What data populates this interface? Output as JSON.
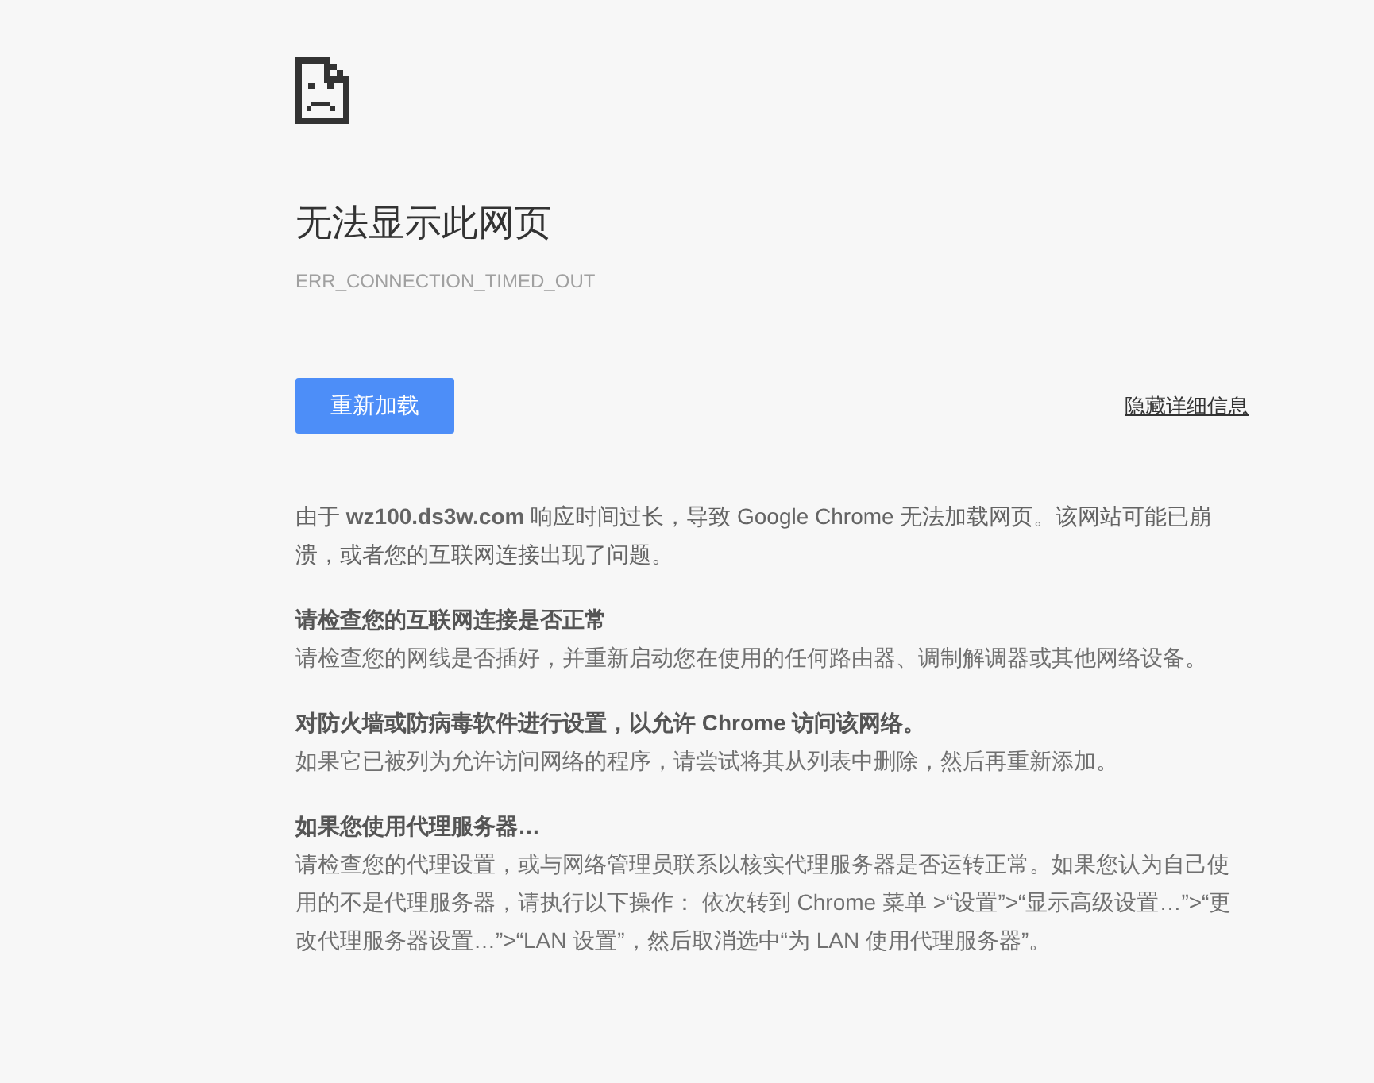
{
  "title": "无法显示此网页",
  "error_code": "ERR_CONNECTION_TIMED_OUT",
  "reload_button": "重新加载",
  "details_link": "隐藏详细信息",
  "summary": "由于 **wz100.ds3w.com** 响应时间过长，导致 Google Chrome 无法加载网页。该网站可能已崩溃，或者您的互联网连接出现了问题。",
  "suggestions": [
    {
      "heading": "请检查您的互联网连接是否正常",
      "body": "请检查您的网线是否插好，并重新启动您在使用的任何路由器、调制解调器或其他网络设备。"
    },
    {
      "heading": "对防火墙或防病毒软件进行设置，以允许 Chrome 访问该网络。",
      "body": "如果它已被列为允许访问网络的程序，请尝试将其从列表中删除，然后再重新添加。"
    },
    {
      "heading": "如果您使用代理服务器…",
      "body": "请检查您的代理设置，或与网络管理员联系以核实代理服务器是否运转正常。如果您认为自己使用的不是代理服务器，请执行以下操作： 依次转到 Chrome 菜单 >“设置”>“显示高级设置…”>“更改代理服务器设置…”>“LAN 设置”，然后取消选中“为 LAN 使用代理服务器”。"
    }
  ]
}
